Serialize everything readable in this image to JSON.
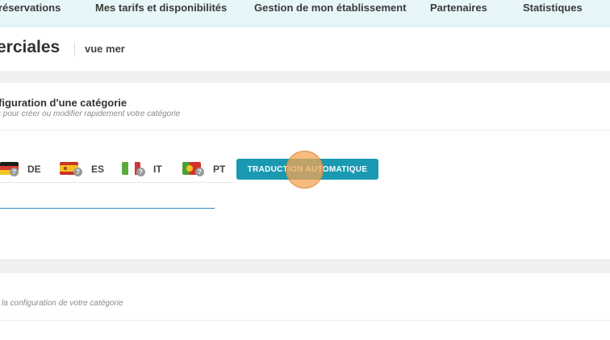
{
  "topnav": {
    "items": [
      {
        "label": "réservations"
      },
      {
        "label": "Mes tarifs et disponibilités"
      },
      {
        "label": "Gestion de mon établissement"
      },
      {
        "label": "Partenaires"
      },
      {
        "label": "Statistiques"
      }
    ]
  },
  "header": {
    "title": "erciales",
    "subtitle": "vue mer"
  },
  "category_config": {
    "title": "figuration d'une catégorie",
    "description": "s pour créer ou modifier rapidement votre catégorie"
  },
  "languages": [
    {
      "code": "DE",
      "flag_icon": "germany-flag-icon",
      "badge": "?"
    },
    {
      "code": "ES",
      "flag_icon": "spain-flag-icon",
      "badge": "?"
    },
    {
      "code": "IT",
      "flag_icon": "italy-flag-icon",
      "badge": "?"
    },
    {
      "code": "PT",
      "flag_icon": "portugal-flag-icon",
      "badge": "?"
    }
  ],
  "translate_button": {
    "label": "TRADUCTION AUTOMATIQUE"
  },
  "second_section": {
    "description": "la configuration de votre catégorie"
  },
  "colors": {
    "accent": "#1a9ab1",
    "nav_bg": "#e7f6f8",
    "input_underline": "#2c8fc2",
    "click_indicator": "#f4a452"
  }
}
